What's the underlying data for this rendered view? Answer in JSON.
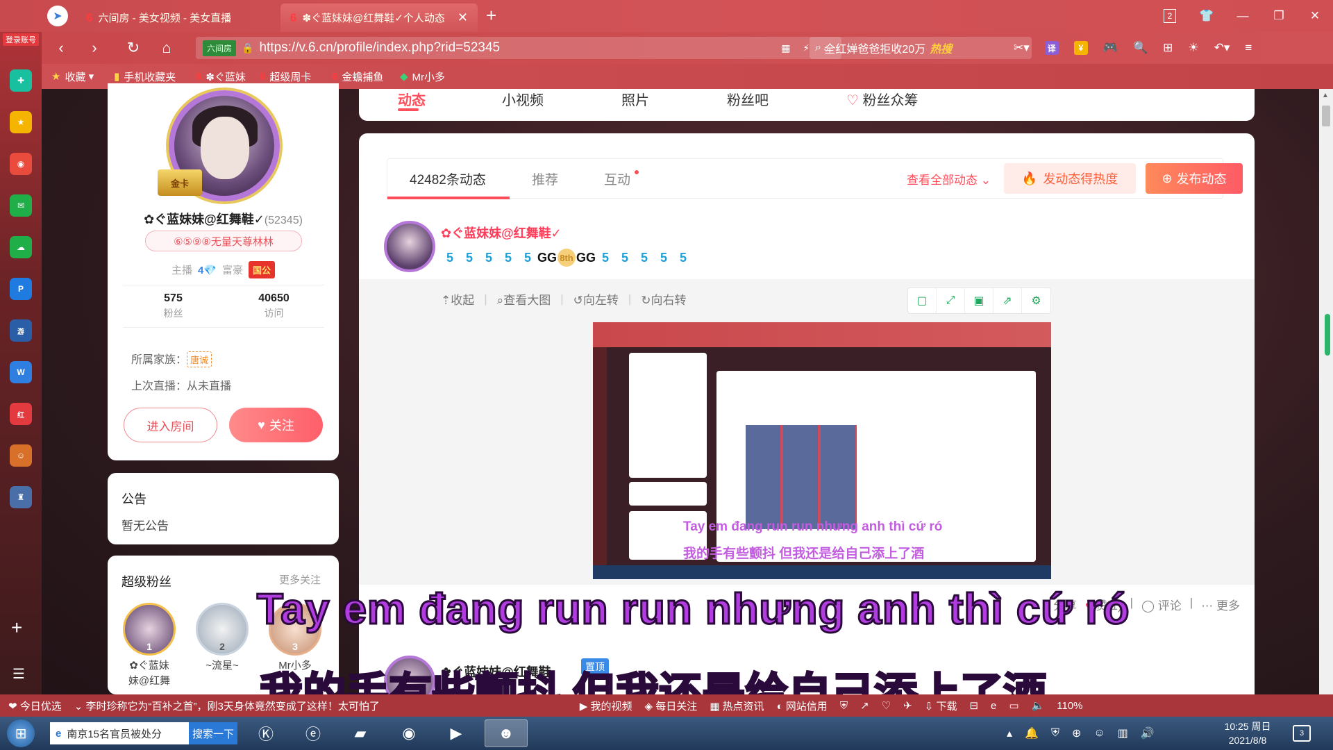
{
  "browser": {
    "account_label": "登录账号",
    "tabs": [
      {
        "label": "六间房 - 美女视频 - 美女直播"
      },
      {
        "label": "✽ぐ蓝妹妹@红舞鞋✓个人动态"
      }
    ],
    "tab_count": "2",
    "url": "https://v.6.cn/profile/index.php?rid=52345",
    "url_badge": "六间房",
    "search_text": "全红婵爸爸拒收20万",
    "search_hot": "热搜",
    "translate_label": "译",
    "favorites": [
      {
        "label": "收藏"
      },
      {
        "label": "手机收藏夹"
      },
      {
        "label": "✽ぐ蓝妹"
      },
      {
        "label": "超级周卡"
      },
      {
        "label": "金蟾捕鱼"
      },
      {
        "label": "Mr小多"
      }
    ]
  },
  "subnav": {
    "items": [
      "动态",
      "小视频",
      "照片",
      "粉丝吧",
      "粉丝众筹"
    ]
  },
  "profile": {
    "gold_card": "金卡",
    "name": "✿ぐ蓝妹妹@红舞鞋✓",
    "rid": "(52345)",
    "title_badge": "⑥⑤⑨⑧无量天尊林林",
    "host_label": "主播",
    "host_level": "4💎",
    "rich_label": "富豪",
    "rich_badge": "国公",
    "fans_count": "575",
    "fans_label": "粉丝",
    "visits_count": "40650",
    "visits_label": "访问",
    "family_label": "所属家族：",
    "family_value": "唐诚",
    "last_live": "上次直播：从未直播",
    "enter_room": "进入房间",
    "follow": "关注"
  },
  "notice": {
    "title": "公告",
    "text": "暂无公告"
  },
  "super_fans": {
    "title": "超级粉丝",
    "more": "更多关注",
    "fans": [
      {
        "rank": "1",
        "name": "✿ぐ蓝妹\n妹@红舞"
      },
      {
        "rank": "2",
        "name": "~流星~"
      },
      {
        "rank": "3",
        "name": "Mr小多"
      }
    ]
  },
  "feed": {
    "tabs": [
      "42482条动态",
      "推荐",
      "互动"
    ],
    "see_all": "查看全部动态",
    "hot_button": "发动态得热度",
    "post_button": "发布动态",
    "post_name": "✿ぐ蓝妹妹@红舞鞋✓",
    "badges": [
      "5",
      "5",
      "5",
      "5",
      "5",
      "GG",
      "8th",
      "GG",
      "5",
      "5",
      "5",
      "5",
      "5"
    ],
    "view_tools": [
      "收起",
      "查看大图",
      "向左转",
      "向右转"
    ],
    "actions": [
      "分享",
      "赞(1)",
      "评论",
      "更多"
    ],
    "post2_name": "✿ぐ蓝妹妹@红舞鞋",
    "pin_label": "置顶",
    "embedded_sub_vi": "Tay em đang run run nhưng anh thì cứ ró",
    "embedded_sub_zh": "我的手有些颤抖 但我还是给自己添上了酒"
  },
  "subtitles": {
    "vi": "Tay em đang run run nhưng anh thì cứ ró",
    "zh": "我的手有些颤抖 但我还是给自己添上了酒"
  },
  "statusbar": {
    "today": "今日优选",
    "news": "李时珍称它为“百补之首”，刚3天身体竟然变成了这样！太可怕了",
    "items": [
      "我的视频",
      "每日关注",
      "热点资讯",
      "网站信用",
      "下载"
    ],
    "zoom": "110%"
  },
  "taskbar": {
    "search_text": "南京15名官员被处分",
    "search_button": "搜索一下",
    "time": "10:25 周日",
    "date": "2021/8/8",
    "notif_count": "3"
  }
}
